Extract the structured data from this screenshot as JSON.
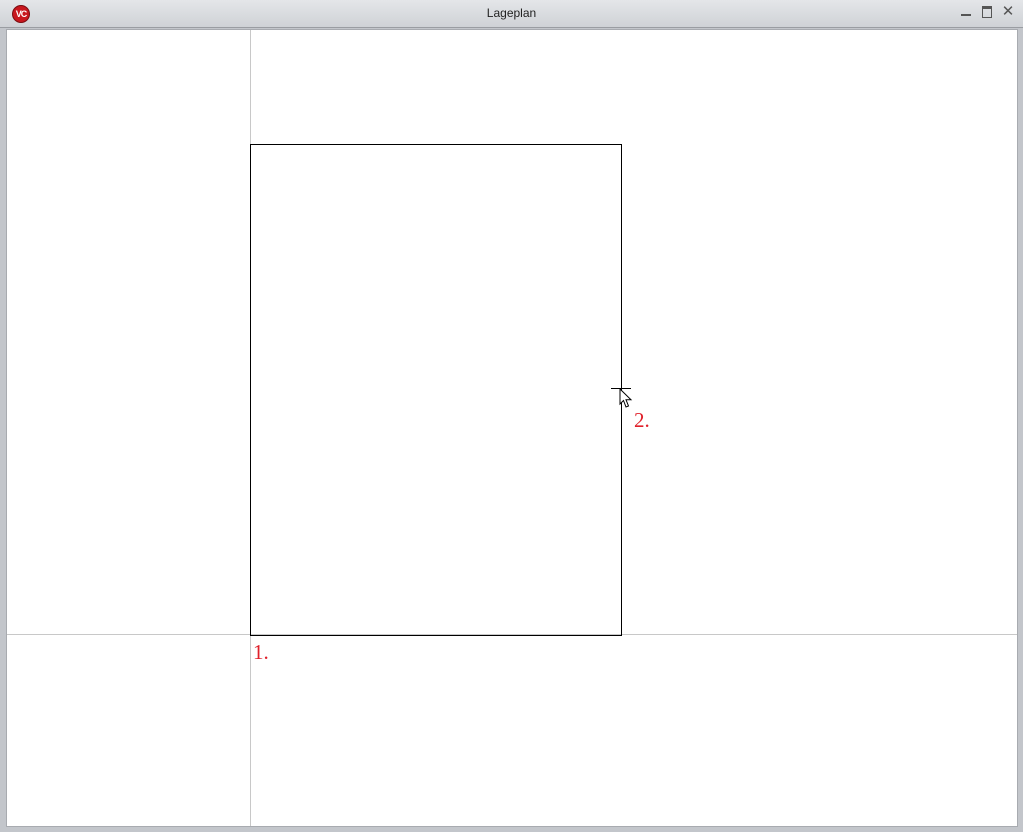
{
  "window": {
    "title": "Lageplan",
    "app_icon_text": "VC",
    "app_icon_color": "#c8171e"
  },
  "controls": {
    "minimize_icon": "minimize-icon",
    "maximize_icon": "maximize-icon",
    "close_icon": "close-icon",
    "close_glyph": "✕"
  },
  "canvas": {
    "background": "#ffffff",
    "point_labels": [
      "1.",
      "2."
    ],
    "label_color": "#e0202a"
  }
}
